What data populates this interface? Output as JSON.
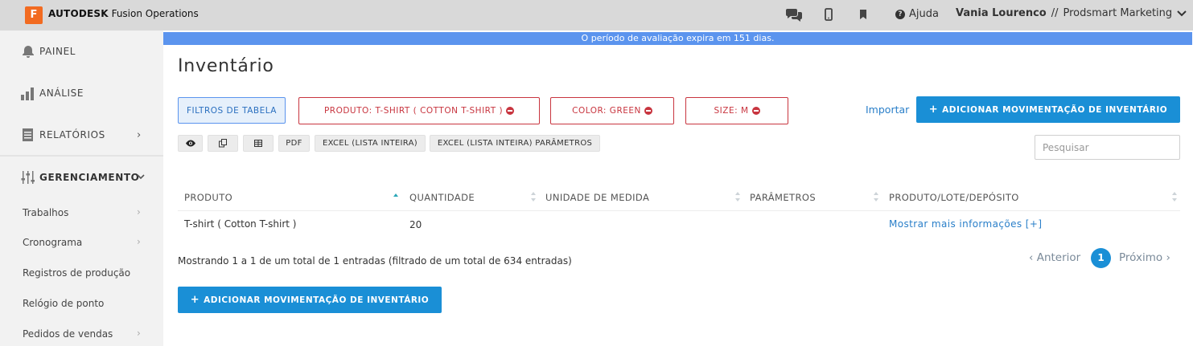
{
  "header": {
    "logo_letter": "F",
    "brand_bold": "AUTODESK",
    "brand_rest": "Fusion Operations",
    "help_label": "Ajuda",
    "user_name": "Vania Lourenco",
    "separator": "//",
    "company": "Prodsmart Marketing"
  },
  "sidebar": {
    "items": [
      {
        "label": "PAINEL",
        "icon": "bell-icon"
      },
      {
        "label": "ANÁLISE",
        "icon": "bar-chart-icon"
      },
      {
        "label": "RELATÓRIOS",
        "icon": "document-icon"
      },
      {
        "label": "GERENCIAMENTO",
        "icon": "sliders-icon"
      }
    ],
    "sub_items": [
      {
        "label": "Trabalhos"
      },
      {
        "label": "Cronograma"
      },
      {
        "label": "Registros de produção"
      },
      {
        "label": "Relógio de ponto"
      },
      {
        "label": "Pedidos de vendas"
      }
    ]
  },
  "banner": {
    "text": "O período de avaliação expira em 151 dias."
  },
  "page": {
    "title": "Inventário",
    "filter_toggle": "FILTROS DE TABELA",
    "filters": [
      {
        "label": "PRODUTO: T-SHIRT ( COTTON T-SHIRT )"
      },
      {
        "label": "COLOR: GREEN"
      },
      {
        "label": "SIZE: M"
      }
    ],
    "import_label": "Importar",
    "add_label": "ADICIONAR MOVIMENTAÇÃO DE INVENTÁRIO",
    "tools": {
      "pdf": "PDF",
      "excel": "EXCEL (LISTA INTEIRA)",
      "excel_params": "EXCEL (LISTA INTEIRA) PARÂMETROS"
    },
    "search_placeholder": "Pesquisar"
  },
  "table": {
    "columns": [
      "PRODUTO",
      "QUANTIDADE",
      "UNIDADE DE MEDIDA",
      "PARÂMETROS",
      "PRODUTO/LOTE/DEPÓSITO"
    ],
    "rows": [
      {
        "produto": "T-shirt ( Cotton T-shirt )",
        "quantidade": "20",
        "unidade": "",
        "parametros": "",
        "detalhes": "Mostrar mais informações [+]"
      }
    ]
  },
  "footer": {
    "info": "Mostrando 1 a 1 de um total de 1 entradas (filtrado de um total de 634 entradas)",
    "prev": "Anterior",
    "current_page": "1",
    "next": "Próximo"
  },
  "colors": {
    "primary": "#1a8fd6",
    "danger": "#c8353f",
    "banner": "#5b94ee",
    "logo": "#f26b21"
  }
}
